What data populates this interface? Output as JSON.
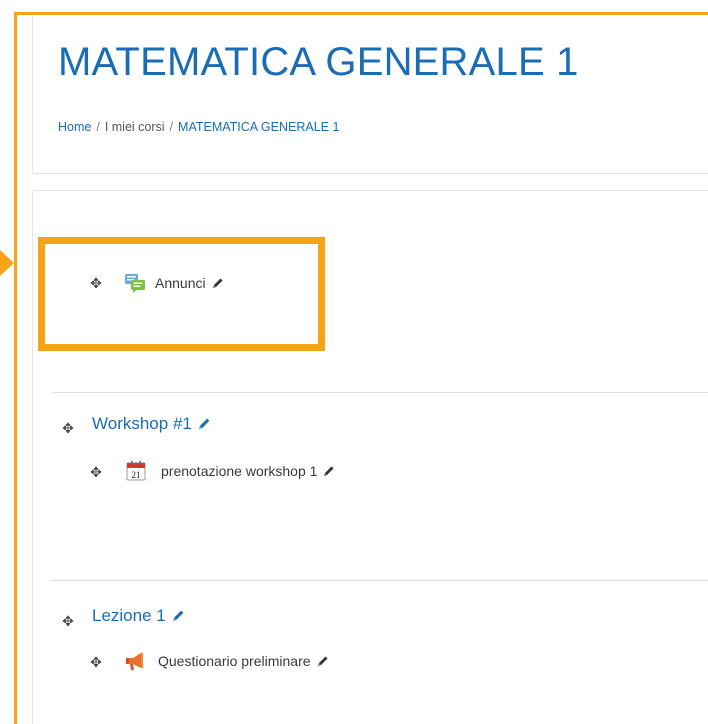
{
  "page": {
    "title": "MATEMATICA GENERALE 1",
    "breadcrumb": [
      {
        "label": "Home"
      },
      {
        "label": "I miei corsi"
      },
      {
        "label": "MATEMATICA GENERALE 1"
      }
    ],
    "separator": "/"
  },
  "colors": {
    "accent": "#f5a417",
    "link": "#1a6cb5",
    "text": "#373a3c"
  },
  "sections": [
    {
      "name": "",
      "activities": [
        {
          "label": "Annunci",
          "icon": "forum-icon"
        }
      ]
    },
    {
      "name": "Workshop #1",
      "activities": [
        {
          "label": "prenotazione workshop 1",
          "icon": "calendar-icon"
        }
      ]
    },
    {
      "name": "Lezione 1",
      "activities": [
        {
          "label": "Questionario preliminare",
          "icon": "megaphone-icon"
        }
      ]
    }
  ],
  "calendar_icon_day": "21"
}
